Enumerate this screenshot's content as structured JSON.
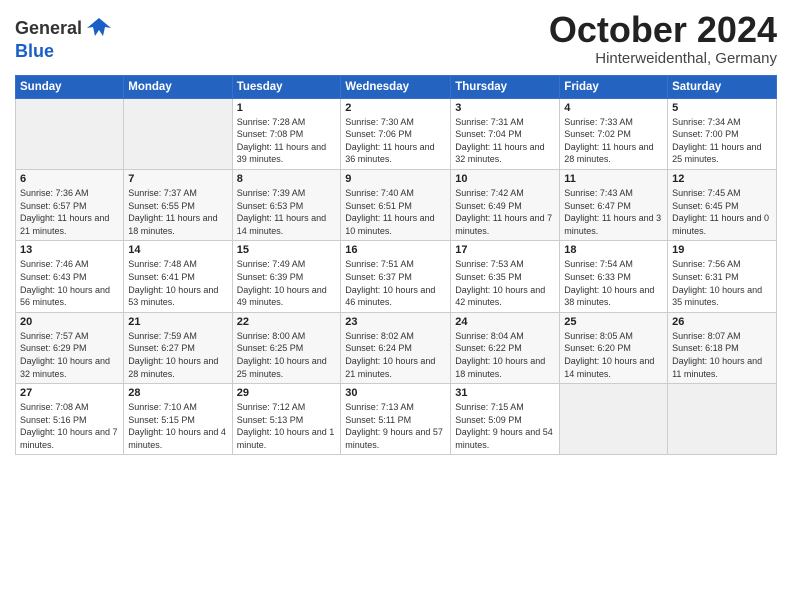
{
  "header": {
    "logo_general": "General",
    "logo_blue": "Blue",
    "month_title": "October 2024",
    "subtitle": "Hinterweidenthal, Germany"
  },
  "weekdays": [
    "Sunday",
    "Monday",
    "Tuesday",
    "Wednesday",
    "Thursday",
    "Friday",
    "Saturday"
  ],
  "weeks": [
    [
      {
        "day": "",
        "info": ""
      },
      {
        "day": "",
        "info": ""
      },
      {
        "day": "1",
        "info": "Sunrise: 7:28 AM\nSunset: 7:08 PM\nDaylight: 11 hours and 39 minutes."
      },
      {
        "day": "2",
        "info": "Sunrise: 7:30 AM\nSunset: 7:06 PM\nDaylight: 11 hours and 36 minutes."
      },
      {
        "day": "3",
        "info": "Sunrise: 7:31 AM\nSunset: 7:04 PM\nDaylight: 11 hours and 32 minutes."
      },
      {
        "day": "4",
        "info": "Sunrise: 7:33 AM\nSunset: 7:02 PM\nDaylight: 11 hours and 28 minutes."
      },
      {
        "day": "5",
        "info": "Sunrise: 7:34 AM\nSunset: 7:00 PM\nDaylight: 11 hours and 25 minutes."
      }
    ],
    [
      {
        "day": "6",
        "info": "Sunrise: 7:36 AM\nSunset: 6:57 PM\nDaylight: 11 hours and 21 minutes."
      },
      {
        "day": "7",
        "info": "Sunrise: 7:37 AM\nSunset: 6:55 PM\nDaylight: 11 hours and 18 minutes."
      },
      {
        "day": "8",
        "info": "Sunrise: 7:39 AM\nSunset: 6:53 PM\nDaylight: 11 hours and 14 minutes."
      },
      {
        "day": "9",
        "info": "Sunrise: 7:40 AM\nSunset: 6:51 PM\nDaylight: 11 hours and 10 minutes."
      },
      {
        "day": "10",
        "info": "Sunrise: 7:42 AM\nSunset: 6:49 PM\nDaylight: 11 hours and 7 minutes."
      },
      {
        "day": "11",
        "info": "Sunrise: 7:43 AM\nSunset: 6:47 PM\nDaylight: 11 hours and 3 minutes."
      },
      {
        "day": "12",
        "info": "Sunrise: 7:45 AM\nSunset: 6:45 PM\nDaylight: 11 hours and 0 minutes."
      }
    ],
    [
      {
        "day": "13",
        "info": "Sunrise: 7:46 AM\nSunset: 6:43 PM\nDaylight: 10 hours and 56 minutes."
      },
      {
        "day": "14",
        "info": "Sunrise: 7:48 AM\nSunset: 6:41 PM\nDaylight: 10 hours and 53 minutes."
      },
      {
        "day": "15",
        "info": "Sunrise: 7:49 AM\nSunset: 6:39 PM\nDaylight: 10 hours and 49 minutes."
      },
      {
        "day": "16",
        "info": "Sunrise: 7:51 AM\nSunset: 6:37 PM\nDaylight: 10 hours and 46 minutes."
      },
      {
        "day": "17",
        "info": "Sunrise: 7:53 AM\nSunset: 6:35 PM\nDaylight: 10 hours and 42 minutes."
      },
      {
        "day": "18",
        "info": "Sunrise: 7:54 AM\nSunset: 6:33 PM\nDaylight: 10 hours and 38 minutes."
      },
      {
        "day": "19",
        "info": "Sunrise: 7:56 AM\nSunset: 6:31 PM\nDaylight: 10 hours and 35 minutes."
      }
    ],
    [
      {
        "day": "20",
        "info": "Sunrise: 7:57 AM\nSunset: 6:29 PM\nDaylight: 10 hours and 32 minutes."
      },
      {
        "day": "21",
        "info": "Sunrise: 7:59 AM\nSunset: 6:27 PM\nDaylight: 10 hours and 28 minutes."
      },
      {
        "day": "22",
        "info": "Sunrise: 8:00 AM\nSunset: 6:25 PM\nDaylight: 10 hours and 25 minutes."
      },
      {
        "day": "23",
        "info": "Sunrise: 8:02 AM\nSunset: 6:24 PM\nDaylight: 10 hours and 21 minutes."
      },
      {
        "day": "24",
        "info": "Sunrise: 8:04 AM\nSunset: 6:22 PM\nDaylight: 10 hours and 18 minutes."
      },
      {
        "day": "25",
        "info": "Sunrise: 8:05 AM\nSunset: 6:20 PM\nDaylight: 10 hours and 14 minutes."
      },
      {
        "day": "26",
        "info": "Sunrise: 8:07 AM\nSunset: 6:18 PM\nDaylight: 10 hours and 11 minutes."
      }
    ],
    [
      {
        "day": "27",
        "info": "Sunrise: 7:08 AM\nSunset: 5:16 PM\nDaylight: 10 hours and 7 minutes."
      },
      {
        "day": "28",
        "info": "Sunrise: 7:10 AM\nSunset: 5:15 PM\nDaylight: 10 hours and 4 minutes."
      },
      {
        "day": "29",
        "info": "Sunrise: 7:12 AM\nSunset: 5:13 PM\nDaylight: 10 hours and 1 minute."
      },
      {
        "day": "30",
        "info": "Sunrise: 7:13 AM\nSunset: 5:11 PM\nDaylight: 9 hours and 57 minutes."
      },
      {
        "day": "31",
        "info": "Sunrise: 7:15 AM\nSunset: 5:09 PM\nDaylight: 9 hours and 54 minutes."
      },
      {
        "day": "",
        "info": ""
      },
      {
        "day": "",
        "info": ""
      }
    ]
  ]
}
